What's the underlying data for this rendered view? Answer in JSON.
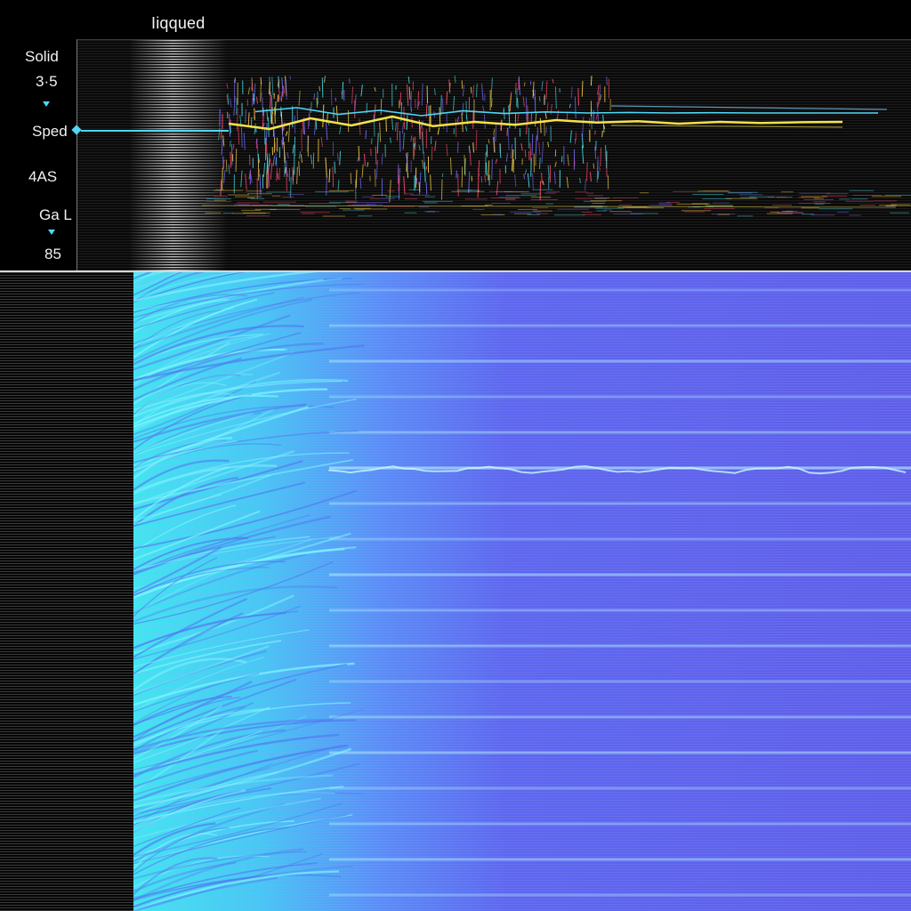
{
  "chart_data": [
    {
      "type": "line",
      "title": "Iiqqued",
      "y_tick_labels": [
        "Solid",
        "3·5",
        "Sped",
        "4AS",
        "Ga L",
        "85"
      ],
      "series": [
        {
          "values": [
            0.55,
            0.7,
            0.4,
            0.6,
            0.35,
            0.62,
            0.5,
            0.58,
            0.45,
            0.52,
            0.48,
            0.55,
            0.5,
            0.53,
            0.51,
            0.5
          ]
        },
        {
          "values": [
            0.45,
            0.3,
            0.55,
            0.4,
            0.6,
            0.42,
            0.52,
            0.46,
            0.5,
            0.48,
            0.5,
            0.49,
            0.5,
            0.5,
            0.5,
            0.5
          ]
        }
      ],
      "colors": {
        "primary_trace": "#f5e24a",
        "secondary_trace": "#4fd7f5",
        "noise": [
          "#ff4a6e",
          "#7a6bff",
          "#46e0e8",
          "#ffd84a"
        ]
      }
    },
    {
      "type": "heatmap",
      "title": "",
      "gradient_colors": [
        "#41e6f0",
        "#46c8f4",
        "#5a8cf6",
        "#5d66ee",
        "#5e5ee9"
      ],
      "band_intensity": [
        0.2,
        0.35,
        0.5,
        0.3,
        0.45,
        0.8,
        0.4,
        0.3,
        0.6,
        0.35,
        0.5,
        0.3,
        0.45,
        0.55,
        0.3,
        0.4,
        0.5,
        0.35
      ]
    }
  ]
}
